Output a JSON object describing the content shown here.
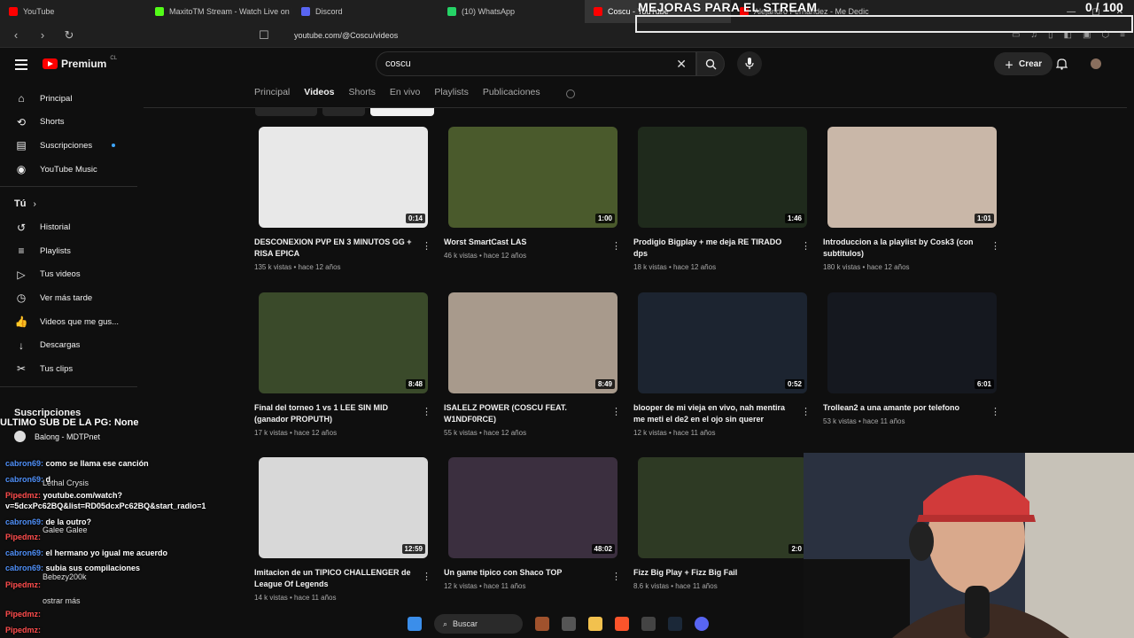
{
  "browser": {
    "tabs": [
      {
        "label": "YouTube",
        "color": "#ff0000"
      },
      {
        "label": "MaxitoTM Stream - Watch Live on Ki",
        "color": "#53fc18"
      },
      {
        "label": "Discord",
        "color": "#5865f2"
      },
      {
        "label": "(10) WhatsApp",
        "color": "#25d366"
      },
      {
        "label": "Coscu - YouTube",
        "color": "#ff0000",
        "active": true
      },
      {
        "label": "Alejandro Fernández - Me Dedic",
        "color": "#ff0000"
      }
    ],
    "url": "youtube.com/@Coscu/videos"
  },
  "overlay": {
    "title": "MEJORAS PARA EL STREAM",
    "counter": "0 / 100"
  },
  "header": {
    "logo_text": "Premium",
    "logo_cc": "CL",
    "search_value": "coscu",
    "create_label": "Crear"
  },
  "sidebar": {
    "items": [
      {
        "label": "Principal",
        "icon": "home-icon",
        "glyph": "⌂"
      },
      {
        "label": "Shorts",
        "icon": "shorts-icon",
        "glyph": "⟲"
      },
      {
        "label": "Suscripciones",
        "icon": "subscriptions-icon",
        "glyph": "▤"
      },
      {
        "label": "YouTube Music",
        "icon": "music-icon",
        "glyph": "◉"
      }
    ],
    "you_header": "Tú",
    "you_items": [
      {
        "label": "Historial",
        "icon": "history-icon",
        "glyph": "↺"
      },
      {
        "label": "Playlists",
        "icon": "playlists-icon",
        "glyph": "≡"
      },
      {
        "label": "Tus videos",
        "icon": "your-videos-icon",
        "glyph": "▷"
      },
      {
        "label": "Ver más tarde",
        "icon": "watch-later-icon",
        "glyph": "◷"
      },
      {
        "label": "Videos que me gus...",
        "icon": "like-icon",
        "glyph": "👍"
      },
      {
        "label": "Descargas",
        "icon": "download-icon",
        "glyph": "↓"
      },
      {
        "label": "Tus clips",
        "icon": "clips-icon",
        "glyph": "✂"
      }
    ],
    "subs_header": "Suscripciones",
    "subs_first": "Balong - MDTPnet"
  },
  "chat": {
    "ultimo": "ULTIMO SUB DE LA PG: None",
    "lines": [
      {
        "user": "cabron69:",
        "text": " como se llama ese canción",
        "cls": "u"
      },
      {
        "user": "cabron69:",
        "text": " d",
        "cls": "u"
      },
      {
        "user": "Pipedmz:",
        "text": " youtube.com/watch?",
        "cls": "u2"
      },
      {
        "user": "",
        "text": "v=5dcxPc62BQ&list=RD05dcxPc62BQ&start_radio=1",
        "cls": "u"
      },
      {
        "user": "cabron69:",
        "text": " de la outro?",
        "cls": "u"
      },
      {
        "user": "Pipedmz:",
        "text": "",
        "cls": "u2"
      },
      {
        "user": "cabron69:",
        "text": " el hermano yo igual me acuerdo",
        "cls": "u"
      },
      {
        "user": "cabron69:",
        "text": " subia sus compilaciones",
        "cls": "u"
      },
      {
        "user": "Pipedmz:",
        "text": "",
        "cls": "u2"
      },
      {
        "user": "Pipedmz:",
        "text": "",
        "cls": "u2"
      },
      {
        "user": "Pipedmz:",
        "text": "",
        "cls": "u2"
      }
    ],
    "ghosts": [
      "Lethal Crysis",
      "Galee Galee",
      "Bebezy200k",
      "ostrar más"
    ]
  },
  "channel_tabs": [
    "Principal",
    "Videos",
    "Shorts",
    "En vivo",
    "Playlists",
    "Publicaciones"
  ],
  "active_tab": "Videos",
  "videos": [
    {
      "title": "DESCONEXION PVP EN 3 MINUTOS GG + RISA EPICA",
      "meta": "135 k vistas • hace 12 años",
      "duration": "0:14",
      "bg": "#e8e8e8"
    },
    {
      "title": "Worst SmartCast LAS",
      "meta": "46 k vistas • hace 12 años",
      "duration": "1:00",
      "bg": "#4a5a2c"
    },
    {
      "title": "Prodigio Bigplay + me deja RE TIRADO dps",
      "meta": "18 k vistas • hace 12 años",
      "duration": "1:46",
      "bg": "#1f2a1c"
    },
    {
      "title": "Introduccion a la playlist by Cosk3 (con subtitulos)",
      "meta": "180 k vistas • hace 12 años",
      "duration": "1:01",
      "bg": "#c9b7a8"
    },
    {
      "title": "Final del torneo 1 vs 1 LEE SIN MID (ganador PROPUTH)",
      "meta": "17 k vistas • hace 12 años",
      "duration": "8:48",
      "bg": "#3a4a2a"
    },
    {
      "title": "ISALELZ POWER (COSCU FEAT. W1NDF0RCE)",
      "meta": "55 k vistas • hace 12 años",
      "duration": "8:49",
      "bg": "#a89a8c"
    },
    {
      "title": "blooper de mi vieja en vivo, nah mentira me meti el de2 en el ojo sin querer",
      "meta": "12 k vistas • hace 11 años",
      "duration": "0:52",
      "bg": "#1c2430"
    },
    {
      "title": "Trollean2 a una amante por telefono",
      "meta": "53 k vistas • hace 11 años",
      "duration": "6:01",
      "bg": "#15181f"
    },
    {
      "title": "Imitacion de un TIPICO CHALLENGER de League Of Legends",
      "meta": "14 k vistas • hace 11 años",
      "duration": "12:59",
      "bg": "#d8d8d8"
    },
    {
      "title": "Un game tipico con Shaco TOP",
      "meta": "12 k vistas • hace 11 años",
      "duration": "48:02",
      "bg": "#3b2f3f"
    },
    {
      "title": "Fizz Big Play + Fizz Big Fail",
      "meta": "8.6 k vistas • hace 11 años",
      "duration": "2:0",
      "bg": "#2e3a24"
    }
  ],
  "taskbar": {
    "search_label": "Buscar"
  }
}
